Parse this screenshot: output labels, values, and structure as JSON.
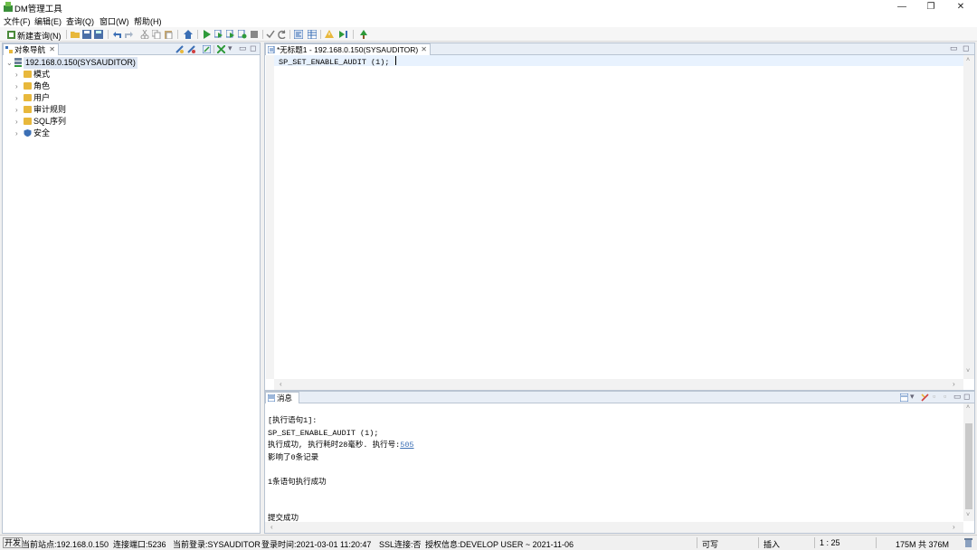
{
  "window": {
    "title": "DM管理工具",
    "minimize": "—",
    "maximize": "❐",
    "close": "✕"
  },
  "menu": [
    "文件(F)",
    "编辑(E)",
    "查询(Q)",
    "窗口(W)",
    "帮助(H)"
  ],
  "toolbar": {
    "new_query": "新建查询(N)"
  },
  "navigator": {
    "tab_label": "对象导航",
    "tab_close": "✕",
    "root_label": "192.168.0.150(SYSAUDITOR)",
    "items": [
      {
        "label": "模式",
        "icon": "folder-icon"
      },
      {
        "label": "角色",
        "icon": "folder-icon"
      },
      {
        "label": "用户",
        "icon": "folder-icon"
      },
      {
        "label": "审计规则",
        "icon": "folder-icon"
      },
      {
        "label": "SQL序列",
        "icon": "folder-icon"
      },
      {
        "label": "安全",
        "icon": "shield-icon"
      }
    ]
  },
  "editor": {
    "tab_label": "*无标题1 - 192.168.0.150(SYSAUDITOR)",
    "tab_close": "✕",
    "code_line": "SP_SET_ENABLE_AUDIT (1);"
  },
  "messages": {
    "tab_label": "消息",
    "lines": [
      "[执行语句1]:",
      "SP_SET_ENABLE_AUDIT (1);",
      "执行成功, 执行耗时28毫秒. 执行号:",
      "影响了0条记录",
      "1条语句执行成功",
      "提交成功"
    ],
    "exec_number": "505"
  },
  "status": {
    "mode": "开发",
    "site": "当前站点:192.168.0.150",
    "port": "连接端口:5236",
    "login": "当前登录:SYSAUDITOR",
    "login_time": "登录时间:2021-03-01 11:20:47",
    "ssl": "SSL连接:否",
    "license": "授权信息:DEVELOP USER ~ 2021-11-06",
    "writable": "可写",
    "insert": "插入",
    "position": "1 : 25",
    "memory": "175M 共 376M"
  },
  "colors": {
    "accent": "#3b6fb5",
    "folder": "#e8b83c",
    "run_green": "#2e9a3a",
    "selected_line": "#e8f2fe"
  }
}
